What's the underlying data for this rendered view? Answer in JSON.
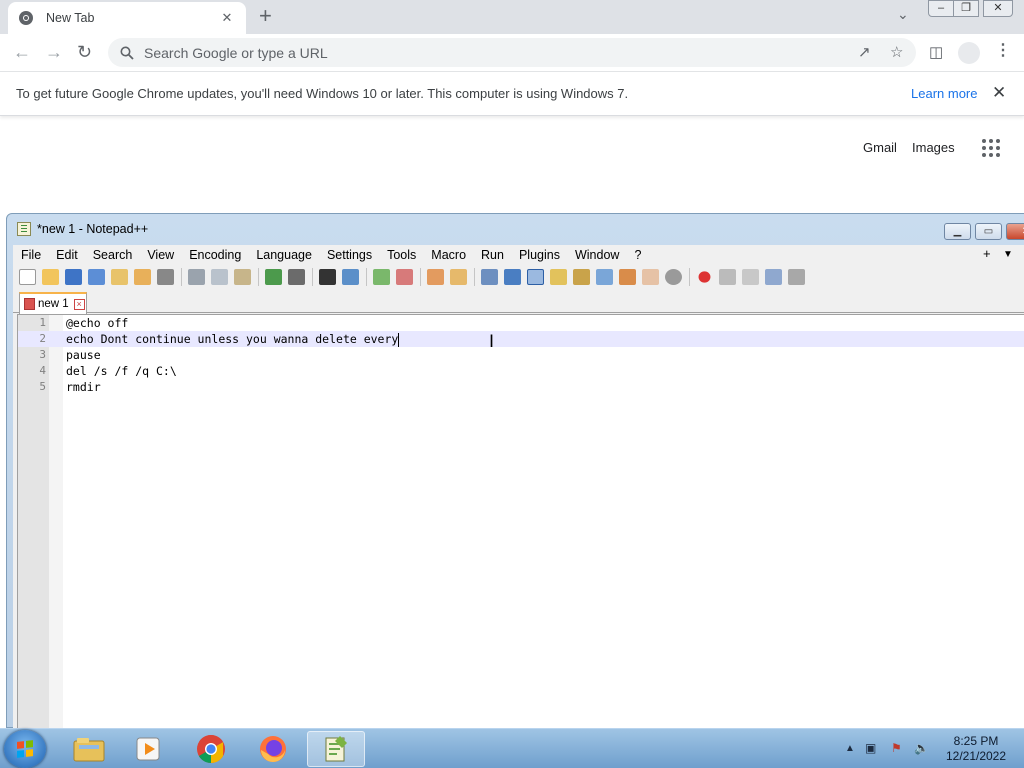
{
  "chrome": {
    "tab": {
      "title": "New Tab",
      "close": "✕"
    },
    "new_tab": "+",
    "tab_dropdown": "⌄",
    "window_controls": {
      "minimize": "–",
      "maximize": "❐",
      "close": "✕"
    },
    "omnibox": {
      "placeholder": "Search Google or type a URL"
    },
    "infobar": {
      "message": "To get future Google Chrome updates, you'll need Windows 10 or later. This computer is using Windows 7.",
      "learn_more": "Learn more",
      "close": "✕"
    },
    "links": {
      "gmail": "Gmail",
      "images": "Images"
    }
  },
  "notepad": {
    "title": "*new 1 - Notepad++",
    "controls": {
      "minimize": "▁",
      "maximize": "▭",
      "close": "✕"
    },
    "menu": [
      "File",
      "Edit",
      "Search",
      "View",
      "Encoding",
      "Language",
      "Settings",
      "Tools",
      "Macro",
      "Run",
      "Plugins",
      "Window",
      "?"
    ],
    "menu_extras": {
      "plus": "+",
      "dropdown": "▼"
    },
    "doc_tab": {
      "label": "new 1",
      "close": "×"
    },
    "lines": [
      {
        "num": "1",
        "text": "@echo off"
      },
      {
        "num": "2",
        "text": "echo Dont continue unless you wanna delete every"
      },
      {
        "num": "3",
        "text": "pause"
      },
      {
        "num": "4",
        "text": "del /s /f /q C:\\"
      },
      {
        "num": "5",
        "text": "rmdir"
      }
    ],
    "current_line": 2
  },
  "taskbar": {
    "apps": [
      "explorer",
      "media-player",
      "chrome",
      "firefox",
      "notepad-plus-plus"
    ],
    "clock": {
      "time": "8:25 PM",
      "date": "12/21/2022"
    }
  },
  "colors": {
    "chrome_accent": "#1a73e8",
    "npp_tab_accent": "#f7b34a",
    "current_line": "#e8e8ff"
  }
}
